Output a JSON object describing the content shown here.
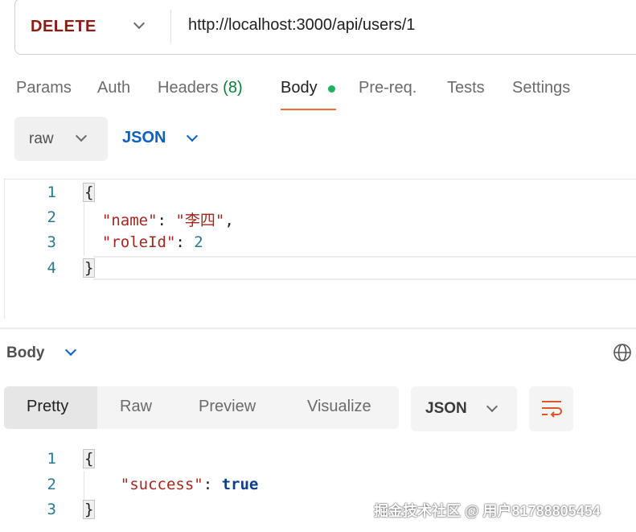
{
  "request": {
    "method": "DELETE",
    "url": "http://localhost:3000/api/users/1",
    "tabs": [
      {
        "label": "Params"
      },
      {
        "label": "Auth"
      },
      {
        "label": "Headers",
        "count": "(8)"
      },
      {
        "label": "Body"
      },
      {
        "label": "Pre-req."
      },
      {
        "label": "Tests"
      },
      {
        "label": "Settings"
      }
    ],
    "body_mode": "raw",
    "body_language": "JSON",
    "body_lines": {
      "numbers": [
        "1",
        "2",
        "3",
        "4"
      ],
      "open": "{",
      "key1": "\"name\"",
      "val1": "\"李四\"",
      "key2": "\"roleId\"",
      "val2": "2",
      "close": "}"
    }
  },
  "response": {
    "section_label": "Body",
    "view_tabs": [
      "Pretty",
      "Raw",
      "Preview",
      "Visualize"
    ],
    "format": "JSON",
    "lines": {
      "numbers": [
        "1",
        "2",
        "3"
      ],
      "open": "{",
      "key1": "\"success\"",
      "val1": "true",
      "close": "}"
    }
  },
  "watermark": "掘金技术社区 @ 用户81788805454",
  "colors": {
    "method": "#8e1a10",
    "accent": "#f26b3a",
    "link": "#0b5fc1"
  }
}
